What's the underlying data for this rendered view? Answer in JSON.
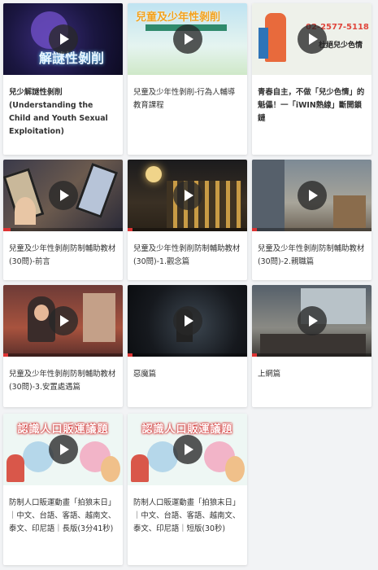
{
  "videos": [
    {
      "title": "兒少解謎性剝削 (Understanding the Child and Youth Sexual Exploitation)",
      "thumb_text": "解謎性剝削"
    },
    {
      "title": "兒童及少年性剝削-行為人輔導教育課程",
      "thumb_text": "兒童及少年性剝削"
    },
    {
      "title": "青春自主，不做「兒少色情」的魁儡！一「iWIN熱線」斷開鎖鏈",
      "thumb_text": "02-2577-5118",
      "thumb_text2": "杜絕兒少色情"
    },
    {
      "title": "兒童及少年性剝削防制輔助教材(30問)-前言"
    },
    {
      "title": "兒童及少年性剝削防制輔助教材(30問)-1.觀念篇"
    },
    {
      "title": "兒童及少年性剝削防制輔助教材(30問)-2.親職篇"
    },
    {
      "title": "兒童及少年性剝削防制輔助教材(30問)-3.安置處遇篇"
    },
    {
      "title": "惡魔篇"
    },
    {
      "title": "上網篇"
    },
    {
      "title": "防制人口販運動畫「拍狼末日」｜中文、台語、客語、越南文、泰文、印尼語｜長版(3分41秒)",
      "thumb_text": "認識人口販運議題"
    },
    {
      "title": "防制人口販運動畫「拍狼末日」｜中文、台語、客語、越南文、泰文、印尼語｜短版(30秒)",
      "thumb_text": "認識人口販運議題"
    }
  ],
  "colors": {
    "accent": "#d33333",
    "card": "#ffffff",
    "background": "#f2f3f5"
  }
}
